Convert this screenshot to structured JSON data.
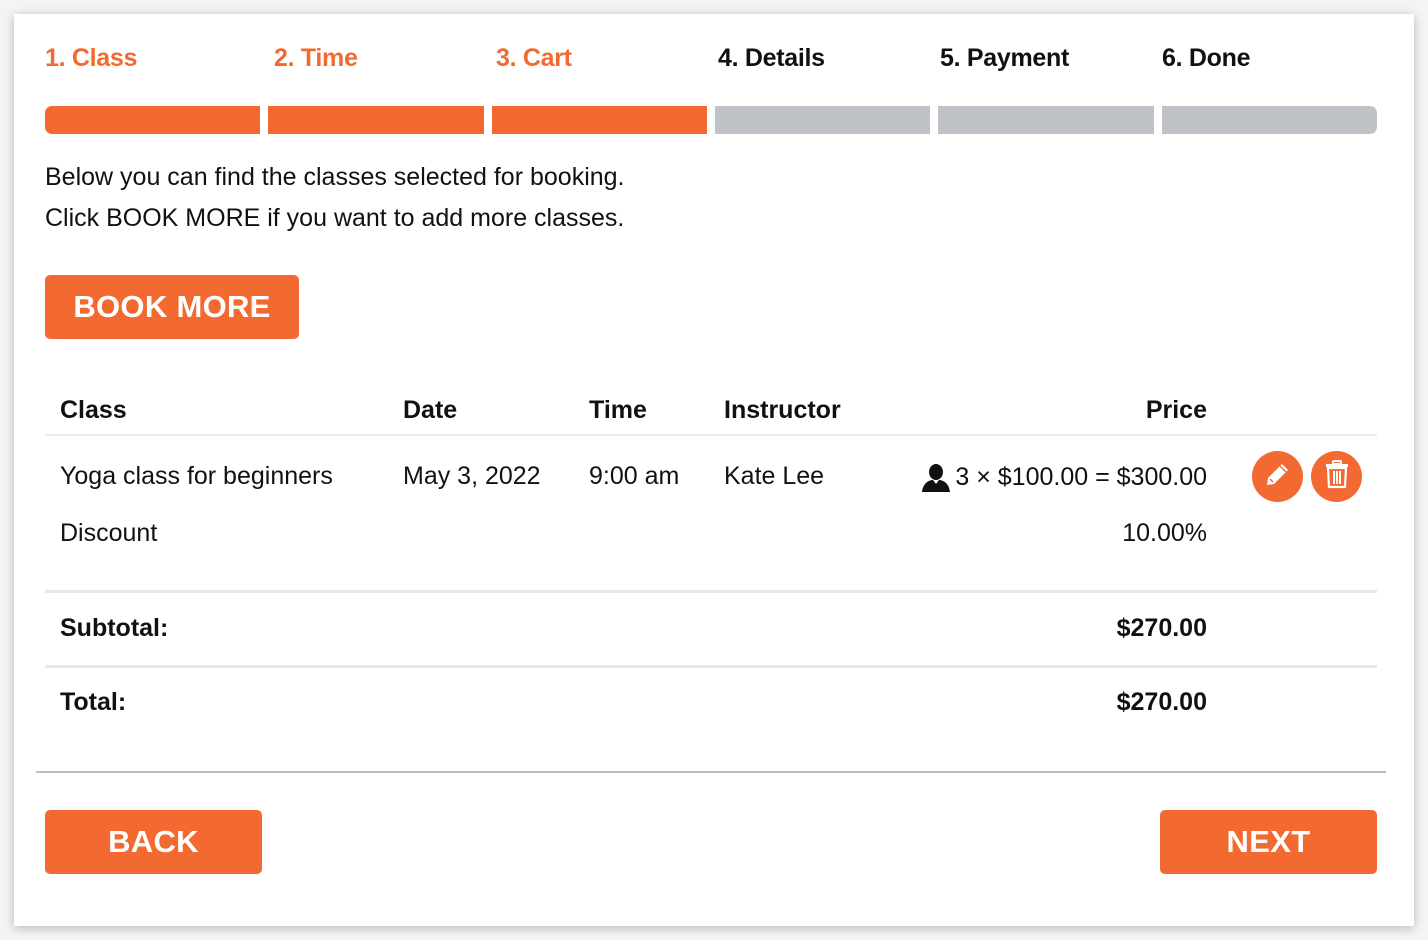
{
  "steps": [
    {
      "label": "1. Class",
      "done": true
    },
    {
      "label": "2. Time",
      "done": true
    },
    {
      "label": "3. Cart",
      "done": true
    },
    {
      "label": "4. Details",
      "done": false
    },
    {
      "label": "5. Payment",
      "done": false
    },
    {
      "label": "6. Done",
      "done": false
    }
  ],
  "colors": {
    "accent": "#f26a31",
    "inactive": "#bfc3c7"
  },
  "intro": {
    "line1": "Below you can find the classes selected for booking.",
    "line2": "Click BOOK MORE if you want to add more classes."
  },
  "buttons": {
    "book_more": "BOOK MORE",
    "back": "BACK",
    "next": "NEXT"
  },
  "table": {
    "headers": {
      "class": "Class",
      "date": "Date",
      "time": "Time",
      "instructor": "Instructor",
      "price": "Price"
    },
    "items": [
      {
        "class": "Yoga class for beginners",
        "date": "May 3, 2022",
        "time": "9:00 am",
        "instructor": "Kate Lee",
        "price": "3 × $100.00 = $300.00",
        "icon": "person-icon"
      }
    ],
    "discount": {
      "label": "Discount",
      "value": "10.00%"
    },
    "subtotal": {
      "label": "Subtotal:",
      "value": "$270.00"
    },
    "total": {
      "label": "Total:",
      "value": "$270.00"
    }
  },
  "icons": {
    "edit": "pencil-icon",
    "delete": "trash-icon",
    "person": "person-icon"
  }
}
